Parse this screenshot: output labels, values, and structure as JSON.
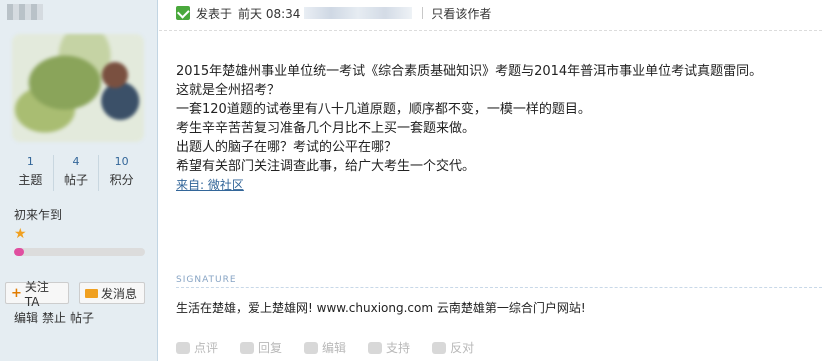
{
  "author": {
    "stats": [
      {
        "value": "1",
        "label": "主题"
      },
      {
        "value": "4",
        "label": "帖子"
      },
      {
        "value": "10",
        "label": "积分"
      }
    ],
    "rank_title": "初来乍到",
    "level_progress": 0.08,
    "follow_label": "关注TA",
    "message_label": "发消息",
    "admin_links": [
      "编辑",
      "禁止",
      "帖子"
    ]
  },
  "post": {
    "posted_prefix": "发表于",
    "posted_time": "前天 08:34",
    "view_author_only": "只看该作者",
    "lines": [
      "2015年楚雄州事业单位统一考试《综合素质基础知识》考题与2014年普洱市事业单位考试真题雷同。",
      "这就是全州招考？",
      "一套120道题的试卷里有八十几道原题，顺序都不变，一模一样的题目。",
      "考生辛辛苦苦复习准备几个月比不上买一套题来做。",
      "出题人的脑子在哪？考试的公平在哪？",
      "希望有关部门关注调查此事，给广大考生一个交代。"
    ],
    "source": "来自: 微社区",
    "signature_label": "SIGNATURE",
    "signature": "生活在楚雄，爱上楚雄网! www.chuxiong.com 云南楚雄第一综合门户网站!",
    "actions": [
      "点评",
      "回复",
      "编辑",
      "支持",
      "反对"
    ]
  },
  "colors": {
    "sidebar_bg": "#e5edf2",
    "link": "#336699",
    "progress_fill": "#e04fa0",
    "online": "#4aa83c"
  }
}
